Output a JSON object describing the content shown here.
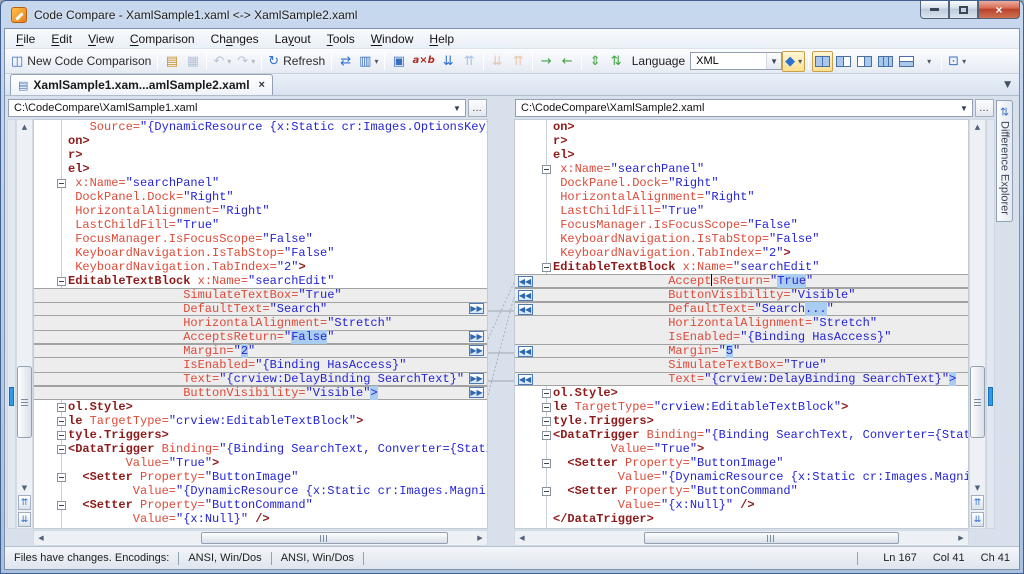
{
  "colors": {
    "accent_blue": "#2E6FD0",
    "active_toggle": "#FFDF8E",
    "close_red": "#B8402B",
    "tok_attr": "#DD4A38",
    "tok_elem": "#8E1B1B",
    "tok_val": "#2424D6",
    "sel_bg": "#A9CDF0",
    "changed_bg": "#EDEDED",
    "box_line": "#A2A2A2",
    "diff_marker": "#2D9BE8"
  },
  "window": {
    "title": "Code Compare - XamlSample1.xaml <-> XamlSample2.xaml"
  },
  "menu": {
    "items": [
      {
        "label": "File",
        "accel": 0
      },
      {
        "label": "Edit",
        "accel": 0
      },
      {
        "label": "View",
        "accel": 0
      },
      {
        "label": "Comparison",
        "accel": 0
      },
      {
        "label": "Changes",
        "accel": 2
      },
      {
        "label": "Layout",
        "accel": 2
      },
      {
        "label": "Tools",
        "accel": 0
      },
      {
        "label": "Window",
        "accel": 0
      },
      {
        "label": "Help",
        "accel": 0
      }
    ]
  },
  "toolbar": {
    "items": [
      {
        "t": "btn",
        "name": "new-code-comparison-button",
        "icon": "◫",
        "c": "#3A6FBF",
        "label": "New Code Comparison"
      },
      {
        "t": "sep"
      },
      {
        "t": "btn",
        "name": "open-file-button",
        "icon": "▤",
        "c": "#C8922B"
      },
      {
        "t": "btn",
        "name": "save-button",
        "icon": "▦",
        "c": "#5A74A0",
        "d": 1
      },
      {
        "t": "sep"
      },
      {
        "t": "btn",
        "name": "undo-button",
        "icon": "↶",
        "c": "#5A74A0",
        "d": 1,
        "dd": 1
      },
      {
        "t": "btn",
        "name": "redo-button",
        "icon": "↷",
        "c": "#5A74A0",
        "d": 1,
        "dd": 1
      },
      {
        "t": "sep"
      },
      {
        "t": "btn",
        "name": "refresh-button",
        "icon": "↻",
        "c": "#2E6FD0",
        "label": "Refresh"
      },
      {
        "t": "sep"
      },
      {
        "t": "btn",
        "name": "compare-details-button",
        "icon": "⇄",
        "c": "#2E6FD0"
      },
      {
        "t": "btn",
        "name": "find-in-document-button",
        "icon": "▥",
        "c": "#3A6FBF",
        "dd": 1
      },
      {
        "t": "sep"
      },
      {
        "t": "btn",
        "name": "structure-comparison-button",
        "icon": "▣",
        "c": "#3A6FBF"
      },
      {
        "t": "btn",
        "name": "word-comparison-button",
        "icon": "a×b",
        "c": "#B32B20",
        "txtic": 1
      },
      {
        "t": "btn",
        "name": "next-difference-button",
        "icon": "⇊",
        "c": "#2E6FD0"
      },
      {
        "t": "btn",
        "name": "previous-difference-button",
        "icon": "⇈",
        "c": "#2E6FD0",
        "d": 1
      },
      {
        "t": "sep"
      },
      {
        "t": "btn",
        "name": "next-conflict-button",
        "icon": "⇊",
        "c": "#D08030",
        "d": 1
      },
      {
        "t": "btn",
        "name": "previous-conflict-button",
        "icon": "⇈",
        "c": "#D08030",
        "d": 1
      },
      {
        "t": "sep"
      },
      {
        "t": "btn",
        "name": "copy-to-right-button",
        "icon": "→",
        "c": "#3FA33F"
      },
      {
        "t": "btn",
        "name": "copy-to-left-button",
        "icon": "←",
        "c": "#3FA33F"
      },
      {
        "t": "sep"
      },
      {
        "t": "btn",
        "name": "expand-all-button",
        "icon": "⇕",
        "c": "#3FA33F"
      },
      {
        "t": "btn",
        "name": "collapse-all-button",
        "icon": "⇅",
        "c": "#3FA33F"
      },
      {
        "t": "label",
        "name": "language-label",
        "label": "Language"
      },
      {
        "t": "combo",
        "name": "language-select",
        "value": "XML"
      },
      {
        "t": "btn",
        "name": "syntax-highlighting-toggle",
        "icon": "◆",
        "c": "#2E6FD0",
        "on": 1,
        "dd": 1
      },
      {
        "t": "sep"
      },
      {
        "t": "lay",
        "name": "layout-two-panes-button",
        "cells": [
          "f",
          "f"
        ],
        "on": 1
      },
      {
        "t": "lay",
        "name": "layout-left-active-button",
        "cells": [
          "f",
          "e"
        ]
      },
      {
        "t": "lay",
        "name": "layout-right-active-button",
        "cells": [
          "e",
          "f"
        ]
      },
      {
        "t": "lay",
        "name": "layout-three-panes-button",
        "cells": [
          "f",
          "f",
          "f"
        ]
      },
      {
        "t": "lay",
        "name": "layout-horizontal-split-button",
        "cells": [
          "e",
          "f"
        ],
        "h": 1
      },
      {
        "t": "btn",
        "name": "layout-options-dropdown",
        "icon": "",
        "dd": 1
      },
      {
        "t": "sep"
      },
      {
        "t": "btn",
        "name": "show-panel-button",
        "icon": "⊡",
        "c": "#3A6FBF",
        "dd": 1
      }
    ]
  },
  "tabs": {
    "active_label": "XamlSample1.xam...amlSample2.xaml"
  },
  "left_pane": {
    "path": "C:\\CodeCompare\\XamlSample1.xaml",
    "lines": [
      {
        "i": 3,
        "segs": [
          [
            "a",
            "Source="
          ],
          [
            "v",
            "\"{DynamicResource {x:Static cr:Images.OptionsKey}"
          ]
        ]
      },
      {
        "i": 0,
        "segs": [
          [
            "e",
            "on>"
          ]
        ]
      },
      {
        "i": 0,
        "segs": [
          [
            "e",
            "r>"
          ]
        ]
      },
      {
        "i": 0,
        "segs": [
          [
            "e",
            "el>"
          ]
        ]
      },
      {
        "i": 1,
        "f": 1,
        "segs": [
          [
            "a",
            "x:Name="
          ],
          [
            "v",
            "\"searchPanel\""
          ]
        ]
      },
      {
        "i": 1,
        "segs": [
          [
            "a",
            "DockPanel.Dock="
          ],
          [
            "v",
            "\"Right\""
          ]
        ]
      },
      {
        "i": 1,
        "segs": [
          [
            "a",
            "HorizontalAlignment="
          ],
          [
            "v",
            "\"Right\""
          ]
        ]
      },
      {
        "i": 1,
        "segs": [
          [
            "a",
            "LastChildFill="
          ],
          [
            "v",
            "\"True\""
          ]
        ]
      },
      {
        "i": 1,
        "segs": [
          [
            "a",
            "FocusManager.IsFocusScope="
          ],
          [
            "v",
            "\"False\""
          ]
        ]
      },
      {
        "i": 1,
        "segs": [
          [
            "a",
            "KeyboardNavigation.IsTabStop="
          ],
          [
            "v",
            "\"False\""
          ]
        ]
      },
      {
        "i": 1,
        "segs": [
          [
            "a",
            "KeyboardNavigation.TabIndex="
          ],
          [
            "v",
            "\"2\""
          ],
          [
            "e",
            ">"
          ]
        ]
      },
      {
        "i": 0,
        "f": 1,
        "segs": [
          [
            "e",
            "EditableTextBlock "
          ],
          [
            "a",
            "x:Name="
          ],
          [
            "v",
            "\"searchEdit\""
          ]
        ]
      },
      {
        "i": 16,
        "c": 1,
        "segs": [
          [
            "a",
            "SimulateTextBox="
          ],
          [
            "v",
            "\"True\""
          ]
        ]
      },
      {
        "i": 16,
        "c": 1,
        "x": 1,
        "b": 1,
        "segs": [
          [
            "a",
            "DefaultText="
          ],
          [
            "v",
            "\"Search\""
          ]
        ]
      },
      {
        "i": 16,
        "c": 1,
        "segs": [
          [
            "a",
            "HorizontalAlignment="
          ],
          [
            "v",
            "\"Stretch\""
          ]
        ]
      },
      {
        "i": 16,
        "c": 1,
        "x": 1,
        "b": 1,
        "segs": [
          [
            "a",
            "AcceptsReturn="
          ],
          [
            "v",
            "\""
          ],
          [
            "s",
            "False"
          ],
          [
            "v",
            "\""
          ]
        ]
      },
      {
        "i": 16,
        "c": 1,
        "x": 1,
        "b": 1,
        "segs": [
          [
            "a",
            "Margin="
          ],
          [
            "v",
            "\""
          ],
          [
            "s",
            "2"
          ],
          [
            "v",
            "\""
          ]
        ]
      },
      {
        "i": 16,
        "c": 1,
        "segs": [
          [
            "a",
            "IsEnabled="
          ],
          [
            "v",
            "\"{Binding HasAccess}\""
          ]
        ]
      },
      {
        "i": 16,
        "c": 1,
        "x": 1,
        "b": 1,
        "segs": [
          [
            "a",
            "Text="
          ],
          [
            "v",
            "\"{crview:DelayBinding SearchText}\""
          ]
        ]
      },
      {
        "i": 16,
        "c": 1,
        "x": 1,
        "b": 1,
        "segs": [
          [
            "a",
            "ButtonVisibility="
          ],
          [
            "v",
            "\"Visible\""
          ],
          [
            "s",
            ">"
          ]
        ]
      },
      {
        "i": 0,
        "f": 1,
        "segs": [
          [
            "e",
            "ol.Style>"
          ]
        ]
      },
      {
        "i": 0,
        "f": 1,
        "segs": [
          [
            "e",
            "le "
          ],
          [
            "a",
            "TargetType="
          ],
          [
            "v",
            "\"crview:EditableTextBlock\""
          ],
          [
            "e",
            ">"
          ]
        ]
      },
      {
        "i": 0,
        "f": 1,
        "segs": [
          [
            "e",
            "tyle.Triggers>"
          ]
        ]
      },
      {
        "i": 0,
        "f": 1,
        "segs": [
          [
            "e",
            "<DataTrigger "
          ],
          [
            "a",
            "Binding="
          ],
          [
            "v",
            "\"{Binding SearchText, Converter={Stati"
          ]
        ]
      },
      {
        "i": 8,
        "segs": [
          [
            "a",
            "Value="
          ],
          [
            "v",
            "\"True\""
          ],
          [
            "e",
            ">"
          ]
        ]
      },
      {
        "i": 2,
        "f": 1,
        "segs": [
          [
            "e",
            "<Setter "
          ],
          [
            "a",
            "Property="
          ],
          [
            "v",
            "\"ButtonImage\""
          ]
        ]
      },
      {
        "i": 9,
        "segs": [
          [
            "a",
            "Value="
          ],
          [
            "v",
            "\"{DynamicResource {x:Static cr:Images.Magni"
          ]
        ]
      },
      {
        "i": 2,
        "f": 1,
        "segs": [
          [
            "e",
            "<Setter "
          ],
          [
            "a",
            "Property="
          ],
          [
            "v",
            "\"ButtonCommand\""
          ]
        ]
      },
      {
        "i": 9,
        "segs": [
          [
            "a",
            "Value="
          ],
          [
            "v",
            "\"{x:Null}\""
          ],
          [
            "e",
            " />"
          ]
        ]
      }
    ]
  },
  "right_pane": {
    "path": "C:\\CodeCompare\\XamlSample2.xaml",
    "lines": [
      {
        "i": 0,
        "segs": [
          [
            "e",
            "on>"
          ]
        ]
      },
      {
        "i": 0,
        "segs": [
          [
            "e",
            "r>"
          ]
        ]
      },
      {
        "i": 0,
        "segs": [
          [
            "e",
            "el>"
          ]
        ]
      },
      {
        "i": 1,
        "f": 1,
        "segs": [
          [
            "a",
            "x:Name="
          ],
          [
            "v",
            "\"searchPanel\""
          ]
        ]
      },
      {
        "i": 1,
        "segs": [
          [
            "a",
            "DockPanel.Dock="
          ],
          [
            "v",
            "\"Right\""
          ]
        ]
      },
      {
        "i": 1,
        "segs": [
          [
            "a",
            "HorizontalAlignment="
          ],
          [
            "v",
            "\"Right\""
          ]
        ]
      },
      {
        "i": 1,
        "segs": [
          [
            "a",
            "LastChildFill="
          ],
          [
            "v",
            "\"True\""
          ]
        ]
      },
      {
        "i": 1,
        "segs": [
          [
            "a",
            "FocusManager.IsFocusScope="
          ],
          [
            "v",
            "\"False\""
          ]
        ]
      },
      {
        "i": 1,
        "segs": [
          [
            "a",
            "KeyboardNavigation.IsTabStop="
          ],
          [
            "v",
            "\"False\""
          ]
        ]
      },
      {
        "i": 1,
        "segs": [
          [
            "a",
            "KeyboardNavigation.TabIndex="
          ],
          [
            "v",
            "\"2\""
          ],
          [
            "e",
            ">"
          ]
        ]
      },
      {
        "i": 0,
        "f": 1,
        "segs": [
          [
            "e",
            "EditableTextBlock "
          ],
          [
            "a",
            "x:Name="
          ],
          [
            "v",
            "\"searchEdit\""
          ]
        ]
      },
      {
        "i": 16,
        "c": 1,
        "x": 1,
        "b": 1,
        "segs": [
          [
            "a",
            "Accept"
          ],
          [
            "k",
            ""
          ],
          [
            "a",
            "sReturn="
          ],
          [
            "v",
            "\""
          ],
          [
            "s",
            "True"
          ],
          [
            "v",
            "\""
          ]
        ]
      },
      {
        "i": 16,
        "c": 1,
        "x": 1,
        "b": 1,
        "segs": [
          [
            "a",
            "ButtonVisibility="
          ],
          [
            "v",
            "\"Visible\""
          ]
        ]
      },
      {
        "i": 16,
        "c": 1,
        "x": 1,
        "b": 1,
        "segs": [
          [
            "a",
            "DefaultText="
          ],
          [
            "v",
            "\"Search"
          ],
          [
            "s",
            "..."
          ],
          [
            "v",
            "\""
          ]
        ]
      },
      {
        "i": 16,
        "c": 1,
        "segs": [
          [
            "a",
            "HorizontalAlignment="
          ],
          [
            "v",
            "\"Stretch\""
          ]
        ]
      },
      {
        "i": 16,
        "c": 1,
        "segs": [
          [
            "a",
            "IsEnabled="
          ],
          [
            "v",
            "\"{Binding HasAccess}\""
          ]
        ]
      },
      {
        "i": 16,
        "c": 1,
        "x": 1,
        "b": 1,
        "segs": [
          [
            "a",
            "Margin="
          ],
          [
            "v",
            "\""
          ],
          [
            "s",
            "5"
          ],
          [
            "v",
            "\""
          ]
        ]
      },
      {
        "i": 16,
        "c": 1,
        "segs": [
          [
            "a",
            "SimulateTextBox="
          ],
          [
            "v",
            "\"True\""
          ]
        ]
      },
      {
        "i": 16,
        "c": 1,
        "x": 1,
        "b": 1,
        "segs": [
          [
            "a",
            "Text="
          ],
          [
            "v",
            "\"{crview:DelayBinding SearchText}\""
          ],
          [
            "s",
            ">"
          ]
        ]
      },
      {
        "i": 0,
        "f": 1,
        "segs": [
          [
            "e",
            "ol.Style>"
          ]
        ]
      },
      {
        "i": 0,
        "f": 1,
        "segs": [
          [
            "e",
            "le "
          ],
          [
            "a",
            "TargetType="
          ],
          [
            "v",
            "\"crview:EditableTextBlock\""
          ],
          [
            "e",
            ">"
          ]
        ]
      },
      {
        "i": 0,
        "f": 1,
        "segs": [
          [
            "e",
            "tyle.Triggers>"
          ]
        ]
      },
      {
        "i": 0,
        "f": 1,
        "segs": [
          [
            "e",
            "<DataTrigger "
          ],
          [
            "a",
            "Binding="
          ],
          [
            "v",
            "\"{Binding SearchText, Converter={Stati"
          ]
        ]
      },
      {
        "i": 8,
        "segs": [
          [
            "a",
            "Value="
          ],
          [
            "v",
            "\"True\""
          ],
          [
            "e",
            ">"
          ]
        ]
      },
      {
        "i": 2,
        "f": 1,
        "segs": [
          [
            "e",
            "<Setter "
          ],
          [
            "a",
            "Property="
          ],
          [
            "v",
            "\"ButtonImage\""
          ]
        ]
      },
      {
        "i": 9,
        "segs": [
          [
            "a",
            "Value="
          ],
          [
            "v",
            "\"{DynamicResource {x:Static cr:Images.Magni"
          ]
        ]
      },
      {
        "i": 2,
        "f": 1,
        "segs": [
          [
            "e",
            "<Setter "
          ],
          [
            "a",
            "Property="
          ],
          [
            "v",
            "\"ButtonCommand\""
          ]
        ]
      },
      {
        "i": 9,
        "segs": [
          [
            "a",
            "Value="
          ],
          [
            "v",
            "\"{x:Null}\""
          ],
          [
            "e",
            " />"
          ]
        ]
      },
      {
        "i": 0,
        "segs": [
          [
            "e",
            "</DataTrigger>"
          ]
        ]
      }
    ]
  },
  "diff_explorer": {
    "label": "Difference Explorer"
  },
  "statusbar": {
    "message": "Files have changes. Encodings:",
    "encoding_left": "ANSI, Win/Dos",
    "encoding_right": "ANSI, Win/Dos",
    "line": "Ln 167",
    "column": "Col 41",
    "char": "Ch 41"
  }
}
